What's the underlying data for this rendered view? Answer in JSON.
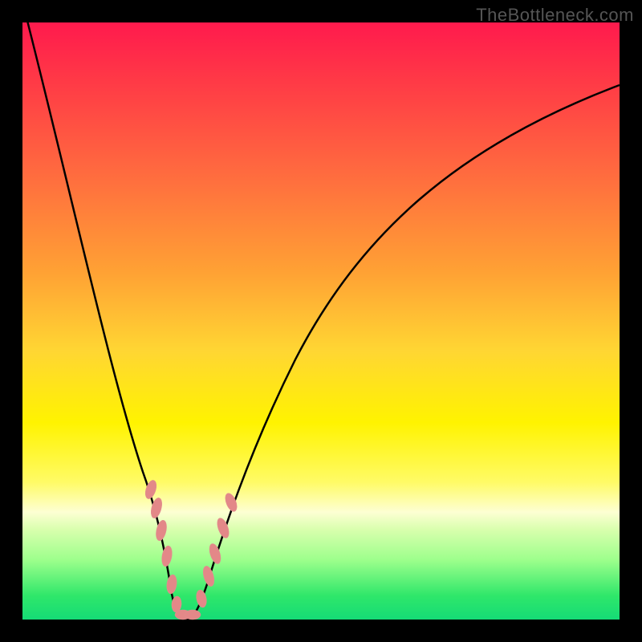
{
  "watermark": "TheBottleneck.com",
  "chart_data": {
    "type": "line",
    "title": "",
    "xlabel": "",
    "ylabel": "",
    "x": [
      0.0,
      0.05,
      0.1,
      0.15,
      0.2,
      0.22,
      0.24,
      0.26,
      0.28,
      0.3,
      0.35,
      0.4,
      0.5,
      0.6,
      0.7,
      0.8,
      0.9,
      1.0
    ],
    "values": [
      1.0,
      0.8,
      0.6,
      0.38,
      0.18,
      0.1,
      0.03,
      0.0,
      0.02,
      0.07,
      0.22,
      0.35,
      0.55,
      0.67,
      0.76,
      0.82,
      0.87,
      0.9
    ],
    "xlim": [
      0,
      1
    ],
    "ylim": [
      0,
      1
    ],
    "marker_points_x": [
      0.205,
      0.215,
      0.225,
      0.235,
      0.245,
      0.255,
      0.265,
      0.28,
      0.3,
      0.31,
      0.32,
      0.33
    ],
    "marker_color": "#e48080",
    "line_color": "#000000"
  },
  "frame": {
    "border_color": "#000000",
    "border_px": 28
  }
}
